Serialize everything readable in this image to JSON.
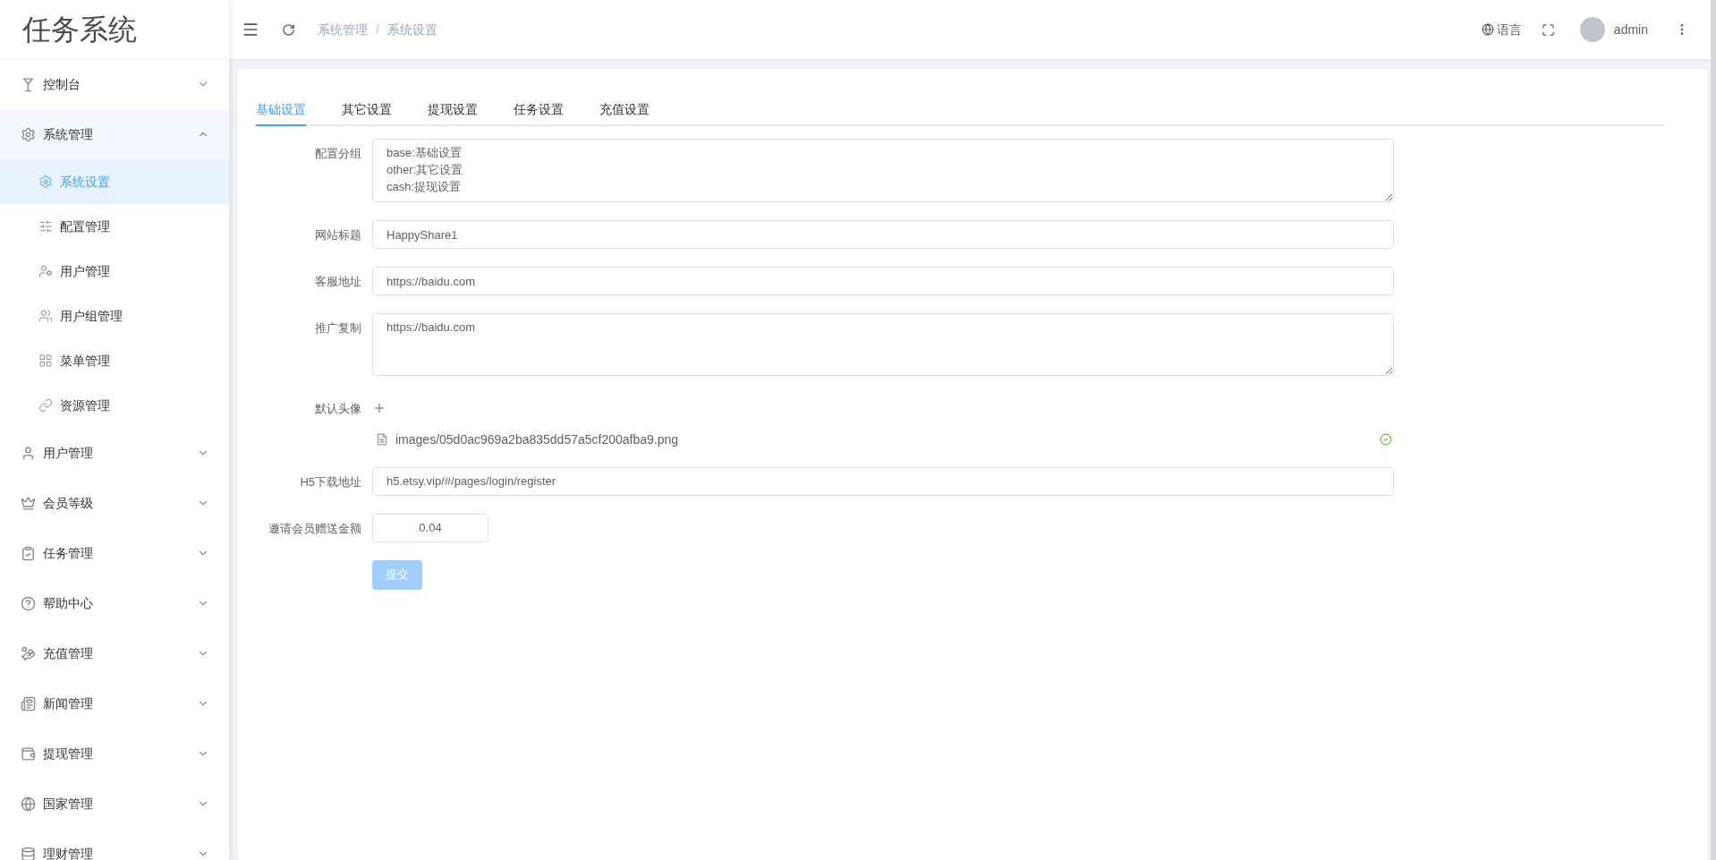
{
  "logo": "任务系统",
  "sidebar": {
    "items": [
      {
        "label": "控制台",
        "expanded": false
      },
      {
        "label": "系统管理",
        "expanded": true,
        "children": [
          {
            "label": "系统设置",
            "selected": true
          },
          {
            "label": "配置管理",
            "selected": false
          },
          {
            "label": "用户管理",
            "selected": false
          },
          {
            "label": "用户组管理",
            "selected": false
          },
          {
            "label": "菜单管理",
            "selected": false
          },
          {
            "label": "资源管理",
            "selected": false
          }
        ]
      },
      {
        "label": "用户管理",
        "expanded": false
      },
      {
        "label": "会员等级",
        "expanded": false
      },
      {
        "label": "任务管理",
        "expanded": false
      },
      {
        "label": "帮助中心",
        "expanded": false
      },
      {
        "label": "充值管理",
        "expanded": false
      },
      {
        "label": "新闻管理",
        "expanded": false
      },
      {
        "label": "提现管理",
        "expanded": false
      },
      {
        "label": "国家管理",
        "expanded": false
      },
      {
        "label": "理财管理",
        "expanded": false
      }
    ]
  },
  "header": {
    "breadcrumb": [
      "系统管理",
      "系统设置"
    ],
    "separator": "/",
    "language": "语言",
    "user": "admin"
  },
  "tabs": [
    {
      "label": "基础设置",
      "selected": true
    },
    {
      "label": "其它设置",
      "selected": false
    },
    {
      "label": "提现设置",
      "selected": false
    },
    {
      "label": "任务设置",
      "selected": false
    },
    {
      "label": "充值设置",
      "selected": false
    }
  ],
  "form": {
    "fields": [
      {
        "kind": "textarea",
        "label": "配置分组",
        "value": "base:基础设置\nother:其它设置\ncash:提现设置"
      },
      {
        "kind": "input",
        "label": "网站标题",
        "value": "HappyShare1"
      },
      {
        "kind": "input",
        "label": "客服地址",
        "value": "https://baidu.com"
      },
      {
        "kind": "textarea",
        "label": "推广复制",
        "value": "https://baidu.com"
      },
      {
        "kind": "upload",
        "label": "默认头像",
        "file": "images/05d0ac969a2ba835dd57a5cf200afba9.png"
      },
      {
        "kind": "input",
        "label": "H5下载地址",
        "value": "h5.etsy.vip/#/pages/login/register"
      },
      {
        "kind": "number",
        "label": "邀请会员赠送金额",
        "value": "0.04"
      }
    ],
    "submit": {
      "label": "提交",
      "disabled": true
    }
  }
}
